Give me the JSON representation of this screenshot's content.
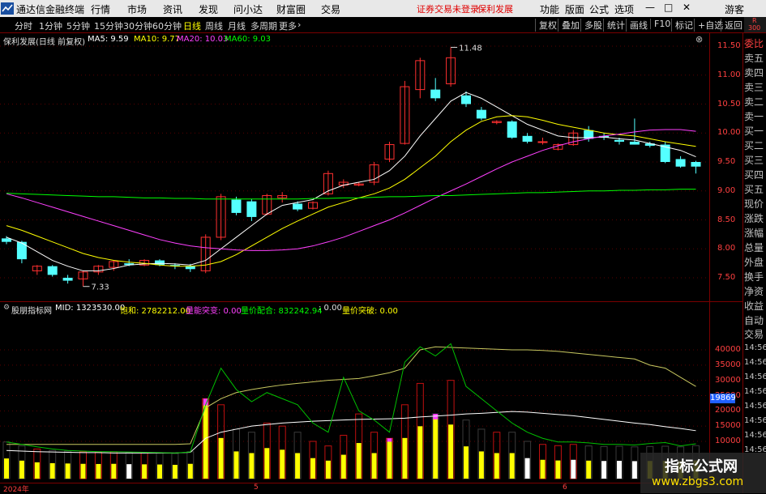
{
  "app": {
    "title": "通达信金融终端",
    "menu": [
      "行情",
      "市场",
      "资讯",
      "发现",
      "问小达",
      "财富圈",
      "交易"
    ],
    "warning": "证券交易未登录",
    "warning_stock": "保利发展",
    "right_menu": [
      "功能",
      "版面",
      "公式",
      "选项"
    ],
    "guest": "游客"
  },
  "toolbar": {
    "periods": [
      "分时",
      "1分钟",
      "5分钟",
      "15分钟",
      "30分钟",
      "60分钟",
      "日线",
      "周线",
      "月线",
      "多周期",
      "更多"
    ],
    "active_period": "日线",
    "right": [
      "复权",
      "叠加",
      "多股",
      "统计",
      "画线",
      "F10",
      "标记",
      "+自选",
      "返回"
    ]
  },
  "badge": {
    "top": "R",
    "bottom": "300"
  },
  "main_legend": {
    "name": "保利发展(日线 前复权)",
    "ma5": "MA5: 9.59",
    "ma10": "MA10: 9.77",
    "ma20": "MA20: 10.03",
    "ma60": "MA60: 9.03"
  },
  "sub_legend": {
    "name": "股朋指标网",
    "mid": "MID: 1323530.00",
    "bao": "饱和: 2782212.00",
    "lnt": "量能突变: 0.00",
    "ljp": "量价配合: 832242.94",
    "blank": ": 0.00",
    "ljt": "量价突破: 0.00"
  },
  "price_labels": {
    "high": "11.48",
    "low": "7.33"
  },
  "price_axis": [
    "11.50",
    "11.00",
    "10.50",
    "10.00",
    "9.50",
    "9.00",
    "8.50",
    "8.00",
    "7.50"
  ],
  "volume_axis": [
    "40000",
    "35000",
    "30000",
    "25000",
    "20000",
    "15000",
    "10000"
  ],
  "volume_cursor": "19869",
  "date_labels": [
    "2024年",
    "5",
    "6"
  ],
  "right_panel": [
    "委比",
    "卖五",
    "卖四",
    "卖三",
    "卖二",
    "卖一",
    "买一",
    "买二",
    "买三",
    "买四",
    "买五",
    "现价",
    "涨跌",
    "涨幅",
    "总量",
    "外盘",
    "换手",
    "净资",
    "收益",
    "自动",
    "交易",
    "14:56",
    "14:56",
    "14:56",
    "14:56",
    "14:56",
    "14:56",
    "14:56",
    "14:56"
  ],
  "watermark": {
    "line1": "指标公式网",
    "line2": "www.zbgs3.com"
  },
  "colors": {
    "up": "#ff3030",
    "down": "#54ffff",
    "ma5": "#ffffff",
    "ma10": "#ffff00",
    "ma20": "#ff40ff",
    "ma60": "#00ff00",
    "accent": "#ffff00"
  },
  "chart_data": [
    {
      "type": "candlestick",
      "title": "保利发展(日线 前复权)",
      "ylim": [
        7.2,
        11.7
      ],
      "ohlc": [
        [
          8.18,
          8.22,
          8.08,
          8.12
        ],
        [
          8.12,
          8.14,
          7.75,
          7.82
        ],
        [
          7.62,
          7.72,
          7.55,
          7.7
        ],
        [
          7.7,
          7.72,
          7.52,
          7.55
        ],
        [
          7.5,
          7.55,
          7.4,
          7.45
        ],
        [
          7.48,
          7.62,
          7.35,
          7.6
        ],
        [
          7.6,
          7.72,
          7.55,
          7.7
        ],
        [
          7.68,
          7.8,
          7.62,
          7.78
        ],
        [
          7.75,
          7.82,
          7.7,
          7.72
        ],
        [
          7.72,
          7.82,
          7.7,
          7.8
        ],
        [
          7.8,
          7.82,
          7.7,
          7.72
        ],
        [
          7.72,
          7.75,
          7.65,
          7.7
        ],
        [
          7.7,
          7.74,
          7.6,
          7.65
        ],
        [
          7.62,
          8.25,
          7.58,
          8.2
        ],
        [
          8.2,
          8.95,
          8.15,
          8.9
        ],
        [
          8.85,
          8.9,
          8.58,
          8.62
        ],
        [
          8.82,
          8.86,
          8.48,
          8.55
        ],
        [
          8.6,
          8.95,
          8.58,
          8.92
        ],
        [
          8.88,
          8.98,
          8.8,
          8.92
        ],
        [
          8.78,
          8.82,
          8.65,
          8.68
        ],
        [
          8.7,
          8.82,
          8.68,
          8.8
        ],
        [
          8.95,
          9.35,
          8.92,
          9.3
        ],
        [
          9.1,
          9.2,
          9.05,
          9.15
        ],
        [
          9.1,
          9.15,
          9.08,
          9.12
        ],
        [
          9.15,
          9.5,
          9.1,
          9.45
        ],
        [
          9.55,
          9.85,
          9.5,
          9.8
        ],
        [
          9.82,
          10.9,
          9.8,
          10.8
        ],
        [
          10.75,
          11.3,
          10.6,
          11.25
        ],
        [
          10.75,
          10.95,
          10.55,
          10.6
        ],
        [
          10.85,
          11.48,
          10.8,
          11.3
        ],
        [
          10.65,
          10.72,
          10.45,
          10.5
        ],
        [
          10.4,
          10.45,
          10.22,
          10.25
        ],
        [
          10.18,
          10.22,
          10.15,
          10.2
        ],
        [
          10.2,
          10.22,
          9.9,
          9.92
        ],
        [
          9.95,
          10.0,
          9.82,
          9.85
        ],
        [
          9.85,
          9.92,
          9.8,
          9.85
        ],
        [
          9.72,
          9.82,
          9.7,
          9.8
        ],
        [
          9.8,
          10.05,
          9.78,
          10.0
        ],
        [
          10.05,
          10.12,
          9.85,
          9.9
        ],
        [
          9.95,
          10.0,
          9.88,
          9.92
        ],
        [
          9.88,
          9.92,
          9.8,
          9.85
        ],
        [
          9.85,
          10.25,
          9.8,
          9.8
        ],
        [
          9.82,
          9.85,
          9.75,
          9.78
        ],
        [
          9.8,
          9.85,
          9.48,
          9.5
        ],
        [
          9.55,
          9.6,
          9.4,
          9.42
        ],
        [
          9.5,
          9.52,
          9.3,
          9.42
        ]
      ],
      "series": [
        {
          "name": "MA5",
          "values": [
            8.2,
            8.1,
            7.95,
            7.8,
            7.7,
            7.62,
            7.62,
            7.66,
            7.72,
            7.74,
            7.75,
            7.74,
            7.72,
            7.8,
            8.0,
            8.2,
            8.4,
            8.6,
            8.75,
            8.8,
            8.85,
            9.0,
            9.1,
            9.15,
            9.2,
            9.35,
            9.6,
            9.95,
            10.25,
            10.55,
            10.7,
            10.6,
            10.45,
            10.3,
            10.15,
            10.05,
            9.95,
            9.92,
            9.92,
            9.93,
            9.9,
            9.88,
            9.82,
            9.76,
            9.7,
            9.59
          ]
        },
        {
          "name": "MA10",
          "values": [
            8.4,
            8.32,
            8.22,
            8.12,
            8.02,
            7.92,
            7.85,
            7.8,
            7.77,
            7.75,
            7.72,
            7.7,
            7.7,
            7.72,
            7.78,
            7.9,
            8.05,
            8.2,
            8.35,
            8.48,
            8.6,
            8.72,
            8.8,
            8.88,
            8.95,
            9.05,
            9.2,
            9.4,
            9.6,
            9.85,
            10.05,
            10.2,
            10.28,
            10.3,
            10.28,
            10.22,
            10.15,
            10.1,
            10.05,
            10.0,
            9.97,
            9.95,
            9.9,
            9.85,
            9.81,
            9.77
          ]
        },
        {
          "name": "MA20",
          "values": [
            8.95,
            8.88,
            8.8,
            8.72,
            8.64,
            8.56,
            8.48,
            8.4,
            8.32,
            8.24,
            8.16,
            8.1,
            8.05,
            8.02,
            8.0,
            7.98,
            7.97,
            7.97,
            7.98,
            8.0,
            8.05,
            8.12,
            8.2,
            8.3,
            8.4,
            8.5,
            8.62,
            8.75,
            8.88,
            9.0,
            9.12,
            9.25,
            9.38,
            9.5,
            9.6,
            9.7,
            9.78,
            9.85,
            9.9,
            9.95,
            9.98,
            10.02,
            10.05,
            10.06,
            10.06,
            10.03
          ]
        },
        {
          "name": "MA60",
          "values": [
            8.96,
            8.95,
            8.94,
            8.93,
            8.92,
            8.91,
            8.9,
            8.9,
            8.89,
            8.88,
            8.88,
            8.87,
            8.87,
            8.86,
            8.86,
            8.86,
            8.86,
            8.86,
            8.86,
            8.86,
            8.87,
            8.87,
            8.88,
            8.88,
            8.89,
            8.9,
            8.9,
            8.91,
            8.92,
            8.92,
            8.93,
            8.94,
            8.95,
            8.96,
            8.97,
            8.97,
            8.98,
            8.99,
            9.0,
            9.0,
            9.01,
            9.01,
            9.02,
            9.02,
            9.03,
            9.03
          ]
        }
      ]
    },
    {
      "type": "bar",
      "title": "股朋指标网",
      "ylim": [
        0,
        43000
      ],
      "values": [
        9800,
        8500,
        7500,
        7000,
        6800,
        6600,
        6500,
        6600,
        6400,
        6300,
        6200,
        6000,
        6600,
        24000,
        22000,
        14000,
        13000,
        16000,
        15000,
        13000,
        10000,
        8500,
        12000,
        19000,
        13000,
        11000,
        22000,
        29000,
        19000,
        30000,
        17000,
        14000,
        13000,
        13000,
        10000,
        9000,
        8600,
        9000,
        8500,
        8300,
        8400,
        8200,
        8300,
        8400,
        8200,
        8600
      ],
      "types": [
        "y",
        "y",
        "y",
        "y",
        "y",
        "y",
        "y",
        "y",
        "w",
        "y",
        "y",
        "y",
        "y",
        "y",
        "y",
        "y",
        "y",
        "y",
        "y",
        "y",
        "y",
        "y",
        "y",
        "y",
        "y",
        "y",
        "y",
        "y",
        "y",
        "y",
        "y",
        "y",
        "y",
        "y",
        "w",
        "y",
        "y",
        "w",
        "y",
        "w",
        "w",
        "w",
        "y",
        "y",
        "y",
        "y"
      ],
      "magenta_tops": [
        13,
        25,
        28
      ],
      "series": [
        {
          "name": "MID",
          "values": [
            7000,
            6800,
            6600,
            6500,
            6400,
            6300,
            6300,
            6200,
            6200,
            6200,
            6200,
            6200,
            6400,
            11000,
            13000,
            14000,
            15000,
            15500,
            16000,
            16300,
            16600,
            16800,
            17000,
            17200,
            17300,
            17400,
            17600,
            18000,
            18300,
            18600,
            19000,
            19200,
            19500,
            19800,
            19600,
            19200,
            18800,
            18400,
            17800,
            17200,
            16600,
            16000,
            15500,
            14800,
            14200,
            13500
          ]
        },
        {
          "name": "饱和",
          "values": [
            9000,
            9000,
            9000,
            9000,
            9000,
            9000,
            9000,
            9000,
            9000,
            9000,
            9000,
            9000,
            9200,
            21000,
            24000,
            26000,
            27000,
            27800,
            28500,
            29000,
            29500,
            30000,
            30300,
            30600,
            31500,
            32500,
            34000,
            40000,
            41000,
            40800,
            40600,
            40400,
            40200,
            40000,
            40000,
            39800,
            39500,
            39000,
            38500,
            38000,
            37500,
            37000,
            35000,
            34000,
            31000,
            28000
          ]
        },
        {
          "name": "量价配合",
          "values": [
            9800,
            9000,
            8200,
            7500,
            7000,
            6800,
            6600,
            6600,
            6500,
            6400,
            6300,
            6200,
            6500,
            22000,
            34000,
            27000,
            23000,
            26000,
            24000,
            22000,
            16000,
            13000,
            31000,
            20000,
            17000,
            13000,
            36000,
            41000,
            38000,
            42000,
            28000,
            24000,
            20000,
            16000,
            13000,
            11000,
            9800,
            9800,
            9500,
            9000,
            9000,
            8800,
            9300,
            9600,
            8500,
            9200
          ]
        }
      ]
    }
  ]
}
